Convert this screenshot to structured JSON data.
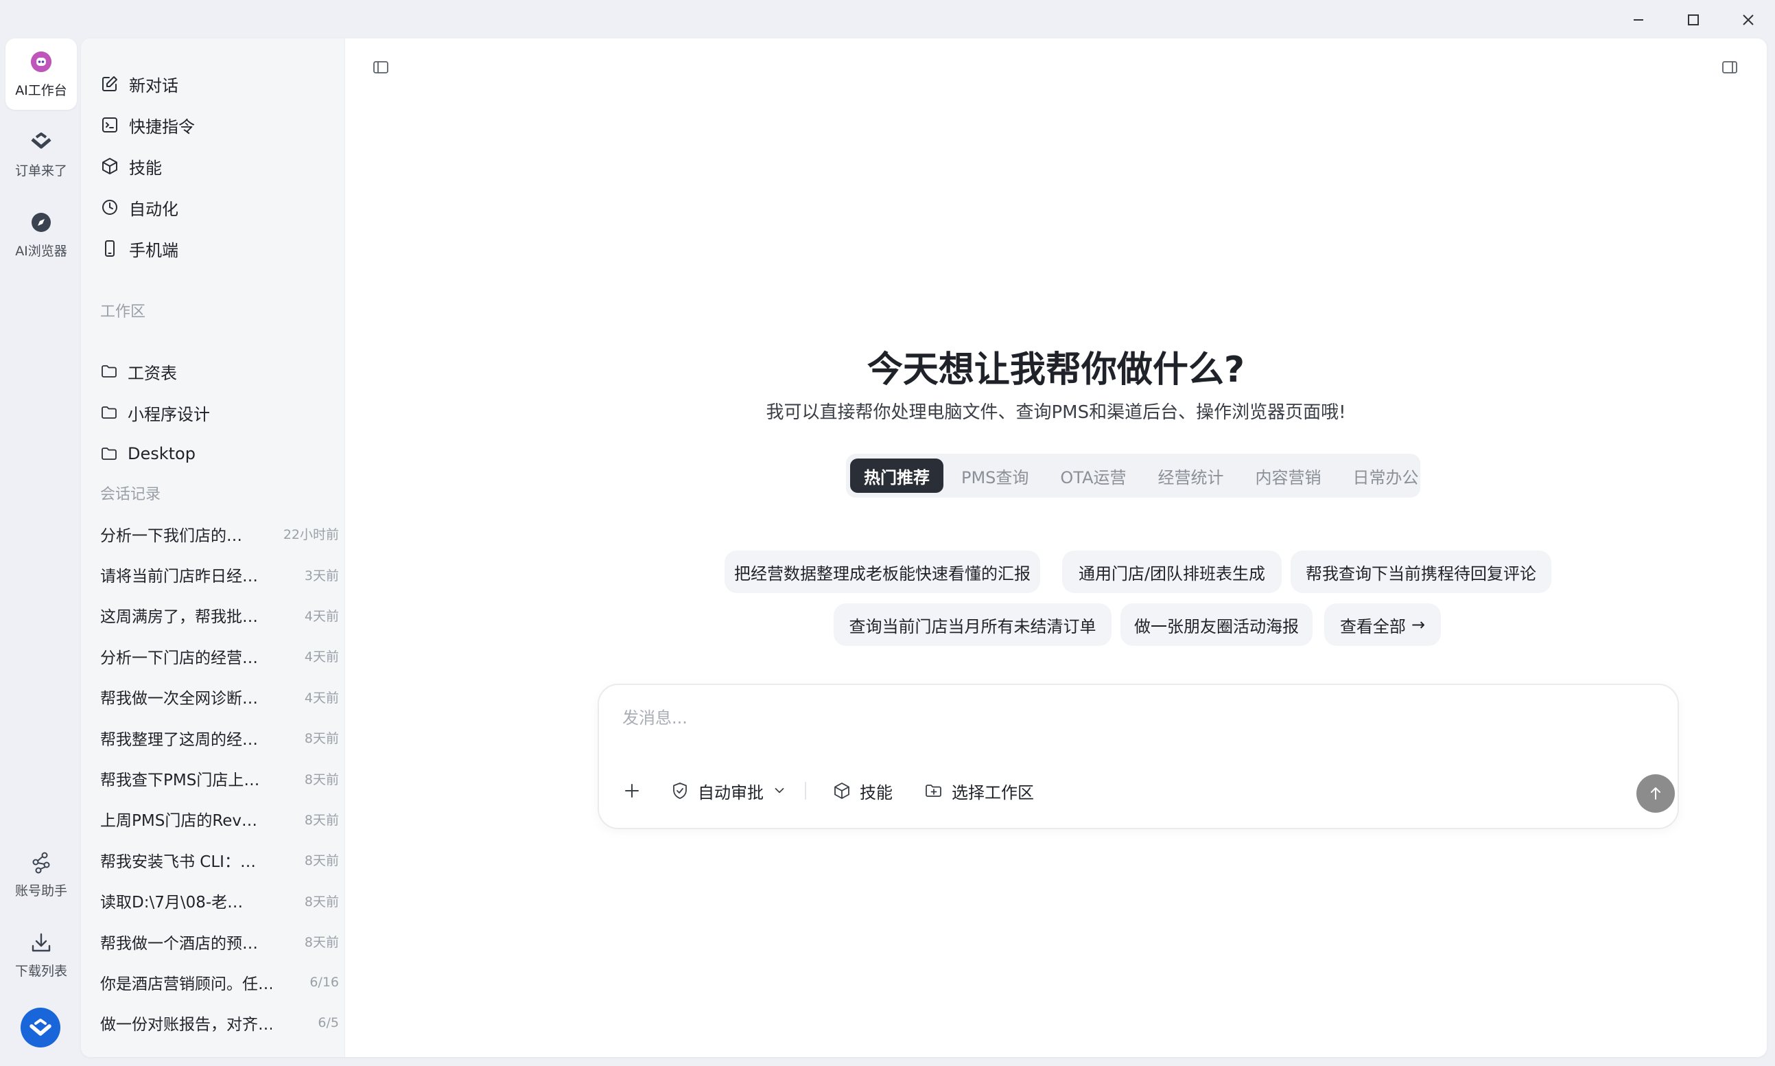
{
  "colors": {
    "window_bg": "#eef0f5",
    "sidebar_bg": "#f5f6f8",
    "accent_dark": "#2a2f37",
    "brand_blue": "#1866d9",
    "send_button": "#8c8c8c"
  },
  "window_controls": [
    "minimize-icon",
    "maximize-icon",
    "close-icon"
  ],
  "rail": {
    "items": [
      {
        "label": "AI工作台",
        "icon": "ai-robot-icon",
        "active": true
      },
      {
        "label": "订单来了",
        "icon": "order-arrow-icon",
        "active": false
      },
      {
        "label": "AI浏览器",
        "icon": "compass-icon",
        "active": false
      }
    ],
    "bottom": [
      {
        "label": "账号助手",
        "icon": "network-nodes-icon"
      },
      {
        "label": "下载列表",
        "icon": "download-icon"
      }
    ],
    "logo_icon": "brand-logo-icon"
  },
  "sidebar": {
    "nav": [
      {
        "label": "新对话",
        "icon": "edit-icon"
      },
      {
        "label": "快捷指令",
        "icon": "terminal-icon"
      },
      {
        "label": "技能",
        "icon": "cube-icon"
      },
      {
        "label": "自动化",
        "icon": "clock-icon"
      },
      {
        "label": "手机端",
        "icon": "phone-icon"
      }
    ],
    "workspace_title": "工作区",
    "workspaces": [
      {
        "label": "工资表",
        "icon": "folder-icon"
      },
      {
        "label": "小程序设计",
        "icon": "folder-icon"
      },
      {
        "label": "Desktop",
        "icon": "folder-icon"
      }
    ],
    "history_title": "会话记录",
    "history": [
      {
        "title": "分析一下我们店的…",
        "time": "22小时前"
      },
      {
        "title": "请将当前门店昨日经…",
        "time": "3天前"
      },
      {
        "title": "这周满房了，帮我批…",
        "time": "4天前"
      },
      {
        "title": "分析一下门店的经营…",
        "time": "4天前"
      },
      {
        "title": "帮我做一次全网诊断…",
        "time": "4天前"
      },
      {
        "title": "帮我整理了这周的经…",
        "time": "8天前"
      },
      {
        "title": "帮我查下PMS门店上…",
        "time": "8天前"
      },
      {
        "title": "上周PMS门店的Rev…",
        "time": "8天前"
      },
      {
        "title": "帮我安装飞书 CLI：…",
        "time": "8天前"
      },
      {
        "title": "读取D:\\7月\\08-老…",
        "time": "8天前"
      },
      {
        "title": "帮我做一个酒店的预…",
        "time": "8天前"
      },
      {
        "title": "你是酒店营销顾问。任…",
        "time": "6/16"
      },
      {
        "title": "做一份对账报告，对齐…",
        "time": "6/5"
      }
    ]
  },
  "main": {
    "toggle_left_icon": "sidebar-toggle-icon",
    "toggle_right_icon": "panel-toggle-icon",
    "title": "今天想让我帮你做什么?",
    "subtitle": "我可以直接帮你处理电脑文件、查询PMS和渠道后台、操作浏览器页面哦!",
    "tabs": [
      {
        "label": "热门推荐",
        "active": true
      },
      {
        "label": "PMS查询",
        "active": false
      },
      {
        "label": "OTA运营",
        "active": false
      },
      {
        "label": "经营统计",
        "active": false
      },
      {
        "label": "内容营销",
        "active": false
      },
      {
        "label": "日常办公",
        "active": false
      }
    ],
    "suggestions": [
      "把经营数据整理成老板能快速看懂的汇报",
      "通用门店/团队排班表生成",
      "帮我查询下当前携程待回复评论",
      "查询当前门店当月所有未结清订单",
      "做一张朋友圈活动海报"
    ],
    "view_all": "查看全部",
    "view_all_arrow": "→",
    "composer": {
      "placeholder": "发消息...",
      "value": "",
      "add_icon": "plus-icon",
      "auto_approve": "自动审批",
      "auto_approve_icon": "shield-check-icon",
      "skills": "技能",
      "skills_icon": "cube-icon",
      "workspace": "选择工作区",
      "workspace_icon": "folder-plus-icon",
      "send_icon": "arrow-up-icon"
    }
  }
}
